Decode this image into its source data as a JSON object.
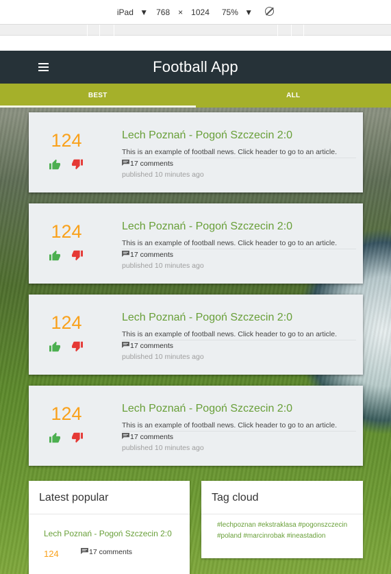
{
  "devtools": {
    "device": "iPad",
    "width": "768",
    "times": "×",
    "height": "1024",
    "zoom": "75%"
  },
  "app": {
    "title": "Football App",
    "tabs": [
      {
        "label": "BEST",
        "active": true
      },
      {
        "label": "ALL",
        "active": false
      }
    ]
  },
  "articles": [
    {
      "score": "124",
      "title": "Lech Poznań - Pogoń Szczecin 2:0",
      "description": "This is an example of football news. Click header to go to an article.",
      "comments": "17 comments",
      "published": "published 10 minutes ago"
    },
    {
      "score": "124",
      "title": "Lech Poznań - Pogoń Szczecin 2:0",
      "description": "This is an example of football news. Click header to go to an article.",
      "comments": "17 comments",
      "published": "published 10 minutes ago"
    },
    {
      "score": "124",
      "title": "Lech Poznań - Pogoń Szczecin 2:0",
      "description": "This is an example of football news. Click header to go to an article.",
      "comments": "17 comments",
      "published": "published 10 minutes ago"
    },
    {
      "score": "124",
      "title": "Lech Poznań - Pogoń Szczecin 2:0",
      "description": "This is an example of football news. Click header to go to an article.",
      "comments": "17 comments",
      "published": "published 10 minutes ago"
    }
  ],
  "latest_popular": {
    "heading": "Latest popular",
    "title": "Lech Poznań - Pogoń Szczecin 2:0",
    "score": "124",
    "comments": "17 comments"
  },
  "tag_cloud": {
    "heading": "Tag cloud",
    "tags": [
      "#lechpoznan",
      "#ekstraklasa",
      "#pogonszczecin",
      "#poland",
      "#marcinrobak",
      "#ineastadion"
    ]
  },
  "colors": {
    "topbar": "#263238",
    "tabs": "#a5b02a",
    "accent_green": "#689f38",
    "score_orange": "#f9a11b",
    "thumb_up": "#4caf50",
    "thumb_down": "#e53935"
  },
  "icons": {
    "menu": "hamburger-menu-icon",
    "up": "thumb-up-icon",
    "down": "thumb-down-icon",
    "comment": "comment-icon",
    "rotate": "rotate-icon"
  }
}
